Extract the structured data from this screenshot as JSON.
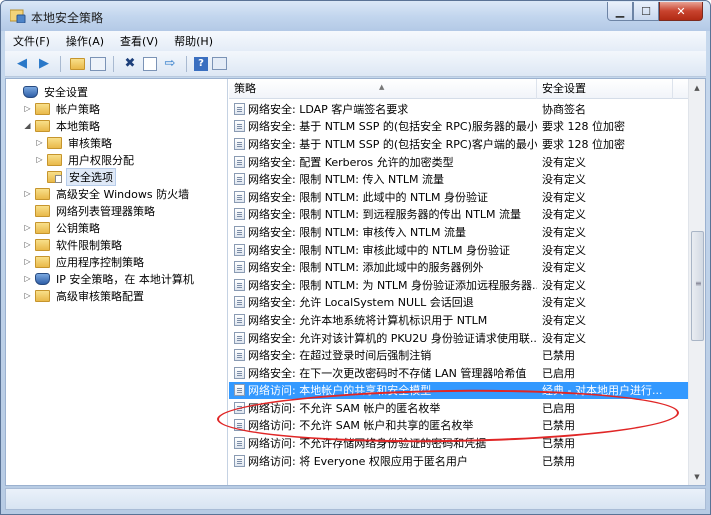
{
  "window": {
    "title": "本地安全策略"
  },
  "menu": [
    "文件(F)",
    "操作(A)",
    "查看(V)",
    "帮助(H)"
  ],
  "toolbar": {
    "icons": [
      "back-arrow",
      "forward-arrow",
      "up-folder",
      "show-hide-tree",
      "delete",
      "properties",
      "export",
      "help",
      "console"
    ]
  },
  "tree": {
    "items": [
      {
        "label": "安全设置",
        "level": 0,
        "expand": "",
        "icon": "shield",
        "selected": false
      },
      {
        "label": "帐户策略",
        "level": 1,
        "expand": "▷",
        "icon": "folder",
        "selected": false
      },
      {
        "label": "本地策略",
        "level": 1,
        "expand": "◢",
        "icon": "folder",
        "selected": false
      },
      {
        "label": "审核策略",
        "level": 2,
        "expand": "▷",
        "icon": "folder",
        "selected": false
      },
      {
        "label": "用户权限分配",
        "level": 2,
        "expand": "▷",
        "icon": "folder",
        "selected": false
      },
      {
        "label": "安全选项",
        "level": 2,
        "expand": "",
        "icon": "folder",
        "selected": true
      },
      {
        "label": "高级安全 Windows 防火墙",
        "level": 1,
        "expand": "▷",
        "icon": "folder",
        "selected": false
      },
      {
        "label": "网络列表管理器策略",
        "level": 1,
        "expand": "",
        "icon": "folder",
        "selected": false
      },
      {
        "label": "公钥策略",
        "level": 1,
        "expand": "▷",
        "icon": "folder",
        "selected": false
      },
      {
        "label": "软件限制策略",
        "level": 1,
        "expand": "▷",
        "icon": "folder",
        "selected": false
      },
      {
        "label": "应用程序控制策略",
        "level": 1,
        "expand": "▷",
        "icon": "folder",
        "selected": false
      },
      {
        "label": "IP 安全策略，在 本地计算机",
        "level": 1,
        "expand": "▷",
        "icon": "shield",
        "selected": false
      },
      {
        "label": "高级审核策略配置",
        "level": 1,
        "expand": "▷",
        "icon": "folder",
        "selected": false
      }
    ]
  },
  "list": {
    "columns": [
      "策略",
      "安全设置"
    ],
    "rows": [
      {
        "policy": "网络安全: LDAP 客户端签名要求",
        "setting": "协商签名",
        "selected": false
      },
      {
        "policy": "网络安全: 基于 NTLM SSP 的(包括安全 RPC)服务器的最小...",
        "setting": "要求 128 位加密",
        "selected": false
      },
      {
        "policy": "网络安全: 基于 NTLM SSP 的(包括安全 RPC)客户端的最小...",
        "setting": "要求 128 位加密",
        "selected": false
      },
      {
        "policy": "网络安全: 配置 Kerberos 允许的加密类型",
        "setting": "没有定义",
        "selected": false
      },
      {
        "policy": "网络安全: 限制 NTLM: 传入 NTLM 流量",
        "setting": "没有定义",
        "selected": false
      },
      {
        "policy": "网络安全: 限制 NTLM: 此域中的 NTLM 身份验证",
        "setting": "没有定义",
        "selected": false
      },
      {
        "policy": "网络安全: 限制 NTLM: 到远程服务器的传出 NTLM 流量",
        "setting": "没有定义",
        "selected": false
      },
      {
        "policy": "网络安全: 限制 NTLM: 审核传入 NTLM 流量",
        "setting": "没有定义",
        "selected": false
      },
      {
        "policy": "网络安全: 限制 NTLM: 审核此域中的 NTLM 身份验证",
        "setting": "没有定义",
        "selected": false
      },
      {
        "policy": "网络安全: 限制 NTLM: 添加此域中的服务器例外",
        "setting": "没有定义",
        "selected": false
      },
      {
        "policy": "网络安全: 限制 NTLM: 为 NTLM 身份验证添加远程服务器...",
        "setting": "没有定义",
        "selected": false
      },
      {
        "policy": "网络安全: 允许 LocalSystem NULL 会话回退",
        "setting": "没有定义",
        "selected": false
      },
      {
        "policy": "网络安全: 允许本地系统将计算机标识用于 NTLM",
        "setting": "没有定义",
        "selected": false
      },
      {
        "policy": "网络安全: 允许对该计算机的 PKU2U 身份验证请求使用联...",
        "setting": "没有定义",
        "selected": false
      },
      {
        "policy": "网络安全: 在超过登录时间后强制注销",
        "setting": "已禁用",
        "selected": false
      },
      {
        "policy": "网络安全: 在下一次更改密码时不存储 LAN 管理器哈希值",
        "setting": "已启用",
        "selected": false
      },
      {
        "policy": "网络访问: 本地帐户的共享和安全模型",
        "setting": "经典 - 对本地用户进行...",
        "selected": true
      },
      {
        "policy": "网络访问: 不允许 SAM 帐户的匿名枚举",
        "setting": "已启用",
        "selected": false
      },
      {
        "policy": "网络访问: 不允许 SAM 帐户和共享的匿名枚举",
        "setting": "已禁用",
        "selected": false
      },
      {
        "policy": "网络访问: 不允许存储网络身份验证的密码和凭据",
        "setting": "已禁用",
        "selected": false
      },
      {
        "policy": "网络访问: 将 Everyone 权限应用于匿名用户",
        "setting": "已禁用",
        "selected": false
      }
    ]
  },
  "colors": {
    "selection": "#3399ff",
    "annotation": "#e02626"
  }
}
